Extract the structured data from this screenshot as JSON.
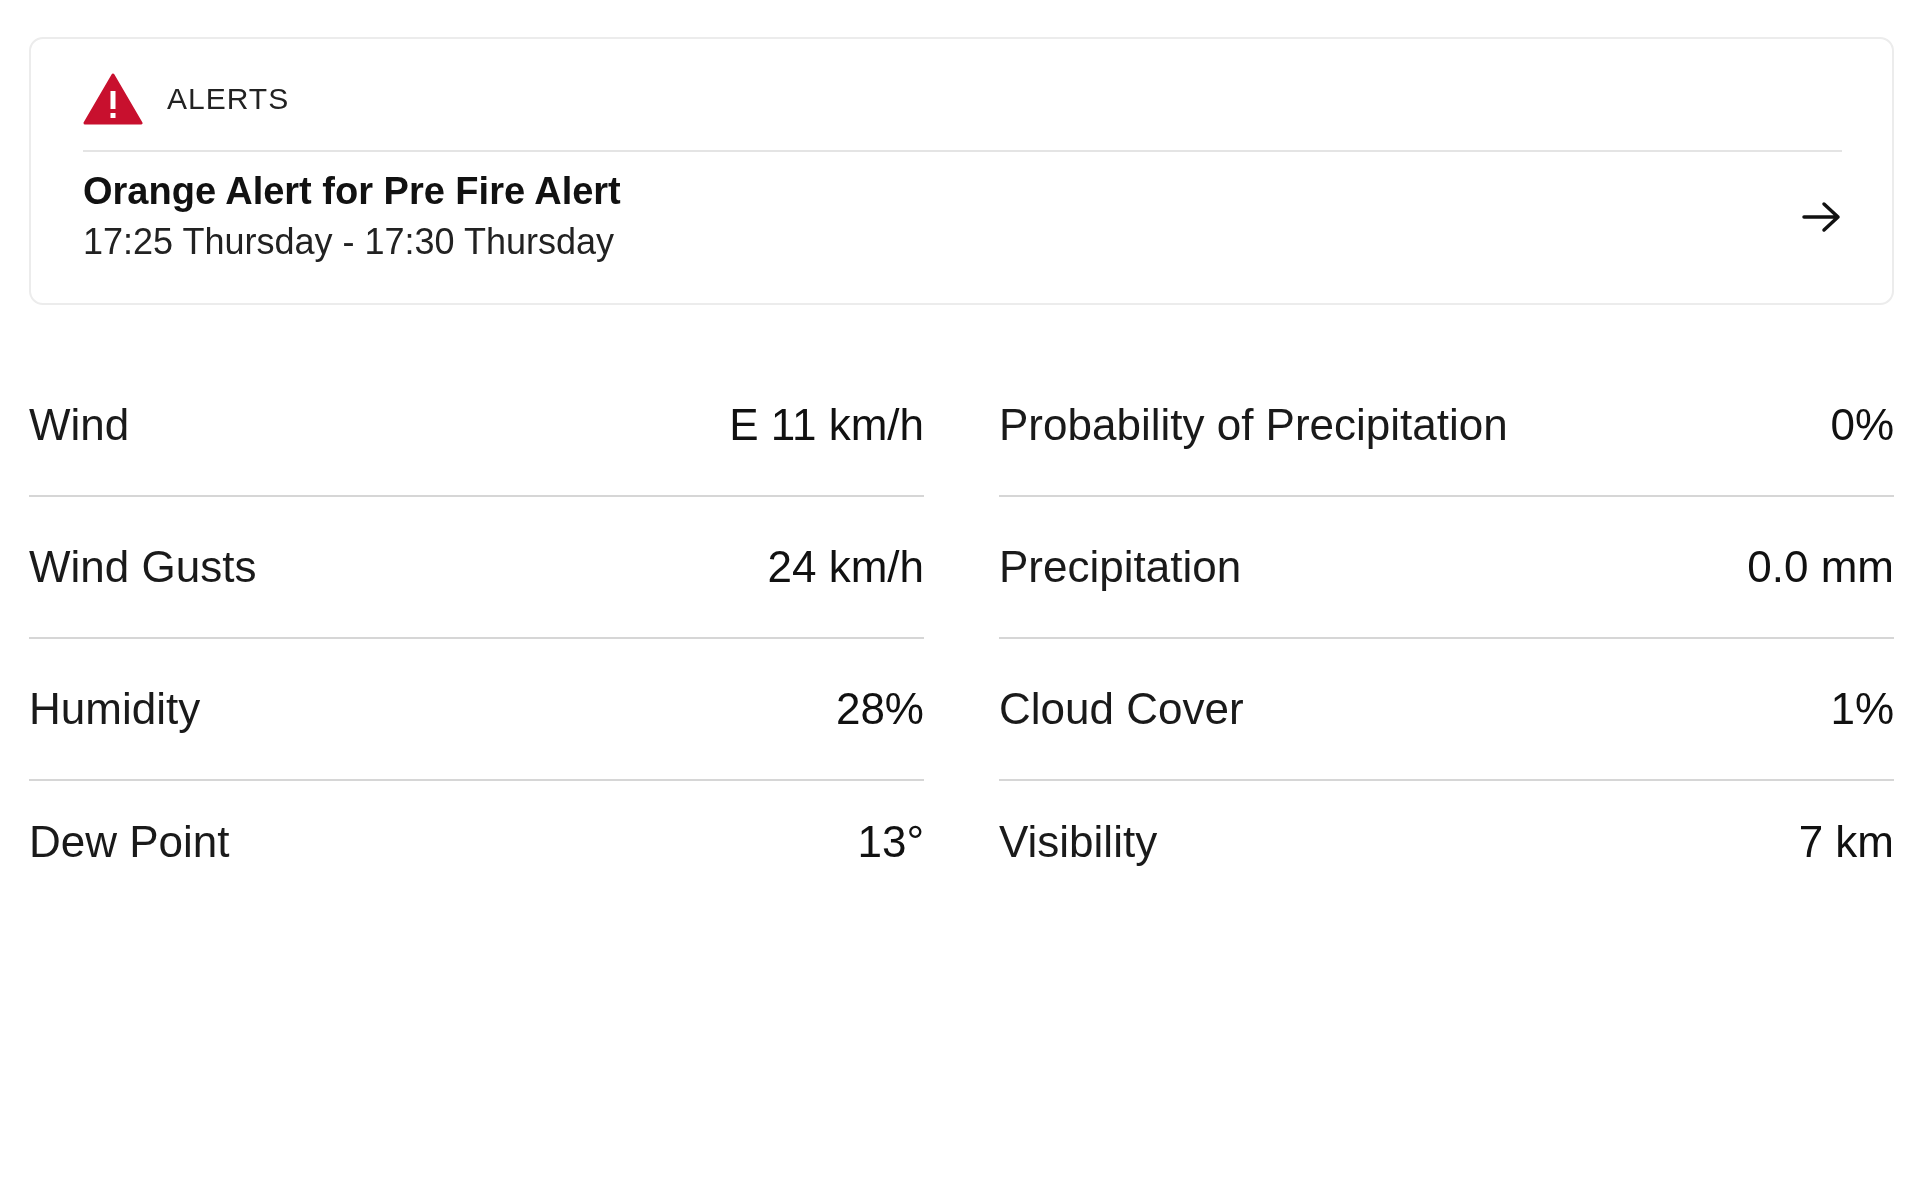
{
  "alerts": {
    "heading": "ALERTS",
    "items": [
      {
        "title": "Orange Alert for Pre Fire Alert",
        "time_range": "17:25 Thursday - 17:30 Thursday"
      }
    ]
  },
  "conditions": {
    "columns": [
      [
        {
          "label": "Wind",
          "value": "E 11 km/h"
        },
        {
          "label": "Wind Gusts",
          "value": "24 km/h"
        },
        {
          "label": "Humidity",
          "value": "28%"
        },
        {
          "label": "Dew Point",
          "value": "13°"
        }
      ],
      [
        {
          "label": "Probability of Precipitation",
          "value": "0%"
        },
        {
          "label": "Precipitation",
          "value": "0.0 mm"
        },
        {
          "label": "Cloud Cover",
          "value": "1%"
        },
        {
          "label": "Visibility",
          "value": "7 km"
        }
      ]
    ]
  }
}
